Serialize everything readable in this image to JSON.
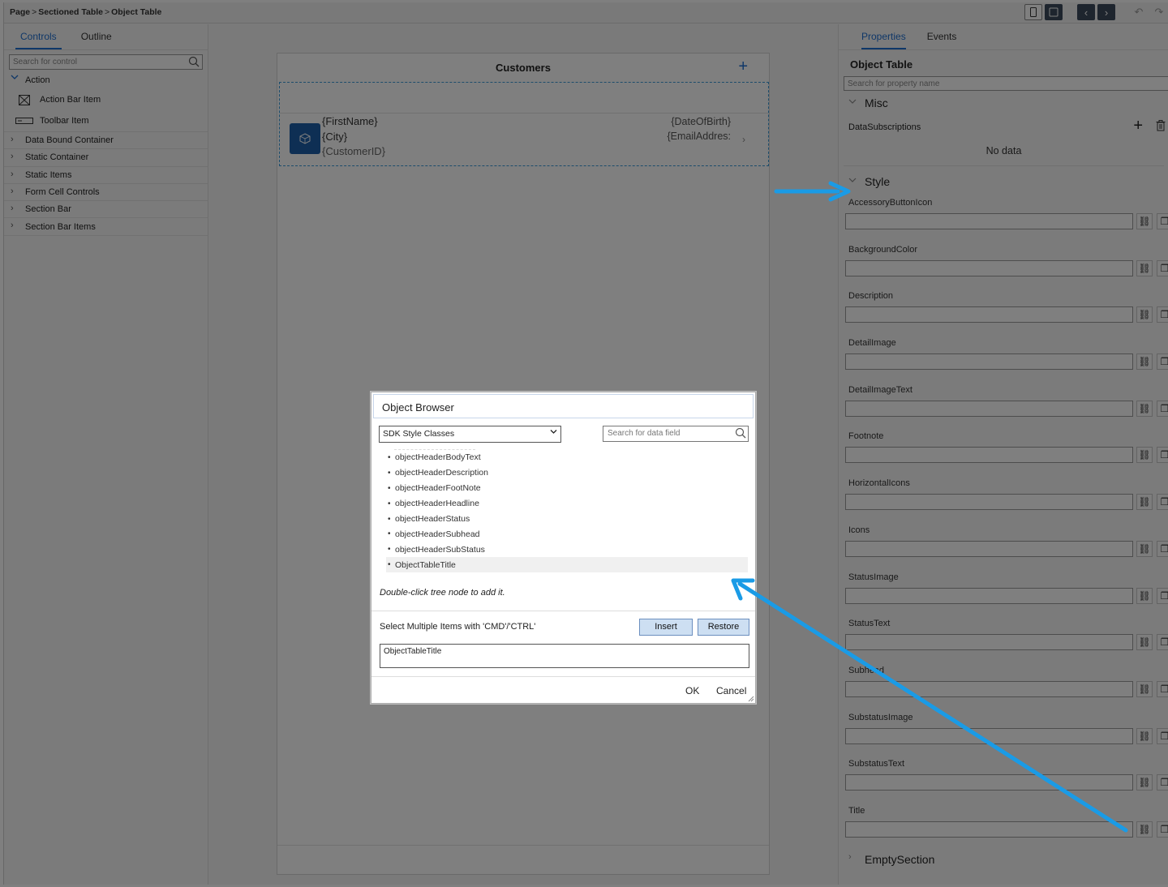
{
  "breadcrumb": [
    "Page",
    "Sectioned Table",
    "Object Table"
  ],
  "left_panel": {
    "tabs": [
      "Controls",
      "Outline"
    ],
    "search_placeholder": "Search for control",
    "tree": {
      "action": "Action",
      "action_items": [
        "Action Bar Item",
        "Toolbar Item"
      ],
      "groups": [
        "Data Bound Container",
        "Static Container",
        "Static Items",
        "Form Cell Controls",
        "Section Bar",
        "Section Bar Items"
      ]
    }
  },
  "canvas": {
    "page_title": "Customers",
    "cell": {
      "line1": "{FirstName}",
      "line2": "{City}",
      "line3": "{CustomerID}",
      "right1": "{DateOfBirth}",
      "right2": "{EmailAddres:"
    }
  },
  "right_panel": {
    "tabs": [
      "Properties",
      "Events"
    ],
    "title": "Object Table",
    "search_placeholder": "Search for property name",
    "misc_label": "Misc",
    "datasubscriptions_label": "DataSubscriptions",
    "no_data": "No data",
    "style_label": "Style",
    "properties": [
      "AccessoryButtonIcon",
      "BackgroundColor",
      "Description",
      "DetailImage",
      "DetailImageText",
      "Footnote",
      "HorizontalIcons",
      "Icons",
      "StatusImage",
      "StatusText",
      "Subhead",
      "SubstatusImage",
      "SubstatusText",
      "Title"
    ],
    "empty_section_label": "EmptySection"
  },
  "dialog": {
    "title": "Object Browser",
    "select_value": "SDK Style Classes",
    "search_placeholder": "Search for data field",
    "items": [
      "objectHeaderBodyText",
      "objectHeaderDescription",
      "objectHeaderFootNote",
      "objectHeaderHeadline",
      "objectHeaderStatus",
      "objectHeaderSubhead",
      "objectHeaderSubStatus",
      "ObjectTableTitle"
    ],
    "hint": "Double-click tree node to add it.",
    "multi_select": "Select Multiple Items with 'CMD'/'CTRL'",
    "insert_label": "Insert",
    "restore_label": "Restore",
    "value": "ObjectTableTitle",
    "ok_label": "OK",
    "cancel_label": "Cancel"
  },
  "colors": {
    "accent": "#1f6fd1",
    "annotation_arrow": "#1a9be6",
    "thumb": "#1d5fa8",
    "button": "#cddff2"
  }
}
